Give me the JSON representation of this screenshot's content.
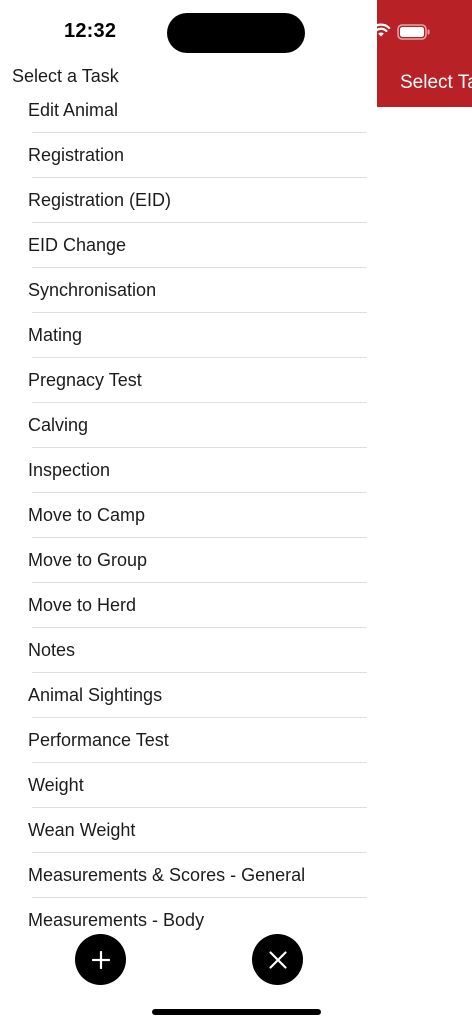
{
  "status_bar": {
    "time": "12:32"
  },
  "background_screen": {
    "header_title": "Select Task",
    "header_color": "#b82226"
  },
  "sheet": {
    "title": "Select a Task",
    "tasks": [
      {
        "label": "Edit Animal"
      },
      {
        "label": "Registration"
      },
      {
        "label": "Registration (EID)"
      },
      {
        "label": "EID Change"
      },
      {
        "label": "Synchronisation"
      },
      {
        "label": "Mating"
      },
      {
        "label": "Pregnacy Test"
      },
      {
        "label": "Calving"
      },
      {
        "label": "Inspection"
      },
      {
        "label": "Move to Camp"
      },
      {
        "label": "Move to Group"
      },
      {
        "label": "Move to Herd"
      },
      {
        "label": "Notes"
      },
      {
        "label": "Animal Sightings"
      },
      {
        "label": "Performance Test"
      },
      {
        "label": "Weight"
      },
      {
        "label": "Wean Weight"
      },
      {
        "label": "Measurements & Scores - General"
      },
      {
        "label": "Measurements - Body"
      }
    ]
  },
  "actions": {
    "add_icon": "plus-icon",
    "close_icon": "close-icon"
  }
}
